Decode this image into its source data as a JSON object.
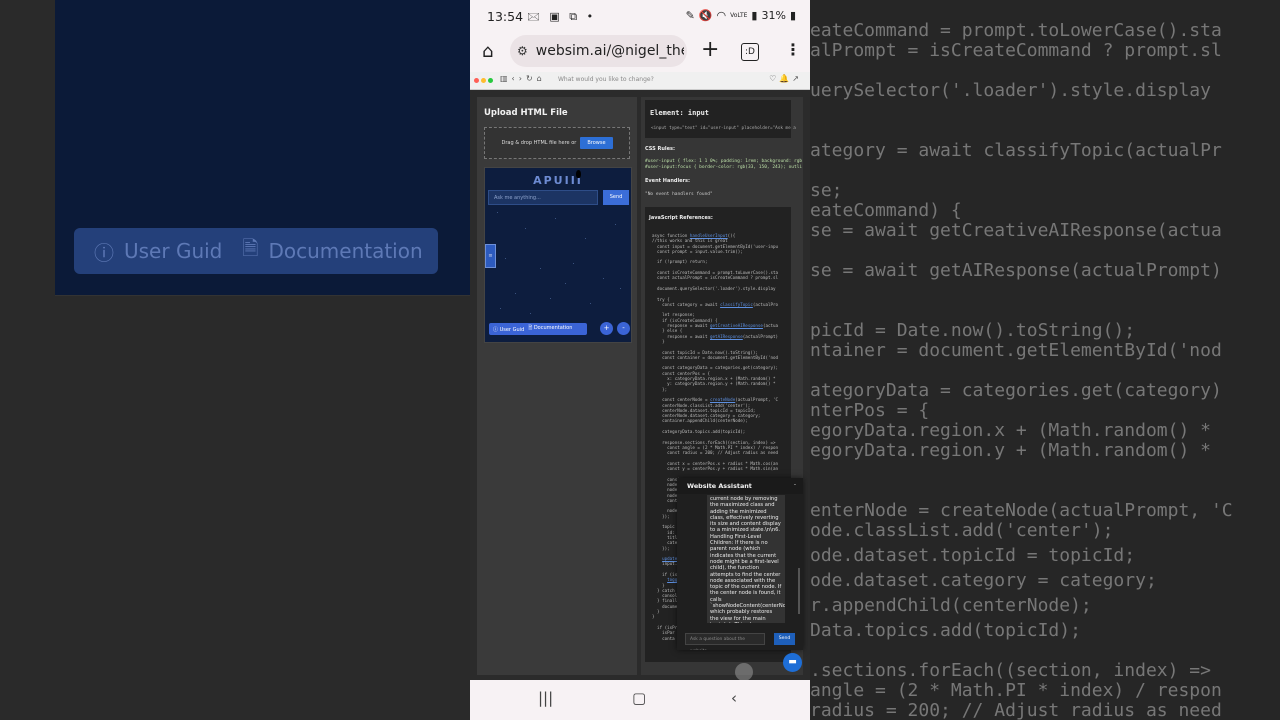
{
  "status_bar": {
    "time": "13:54",
    "notif_icons": "🖂 ▣ ⧉ •",
    "battery": "31%",
    "signal_label": "VoLTE"
  },
  "browser": {
    "url": "websim.ai/@nigel_the_m",
    "tab_count": ":D",
    "inner_prompt": "What would you like to change?"
  },
  "left_panel": {
    "title": "Upload HTML File",
    "drop_text": "Drag & drop HTML file here or",
    "browse_label": "Browse"
  },
  "preview": {
    "app_title": "APUIII",
    "input_placeholder": "Ask me anything...",
    "send_label": "Send",
    "user_guide_label": "User Guid",
    "documentation_label": "Documentation",
    "plus_label": "+",
    "minus_label": "-"
  },
  "inspector": {
    "element_title": "Element: input",
    "element_code": "<input type=\"text\" id=\"user-input\" placeholder=\"Ask me a",
    "css_label": "CSS Rules:",
    "css_line1": "#user-input { flex: 1 1 0%; padding: 1rem; background: rgb",
    "css_line2": "#user-input:focus { border-color: rgb(33, 150, 243); outli",
    "events_label": "Event Handlers:",
    "events_text": "\"No event handlers found\"",
    "js_label": "JavaScript References:",
    "code_lines": [
      "async function handleUserInput(){",
      "//this works and this is great",
      "  const input = document.getElementById('user-inpu",
      "  const prompt = input.value.trim();",
      "",
      "  if (!prompt) return;",
      "",
      "  const isCreateCommand = prompt.toLowerCase().sta",
      "  const actualPrompt = isCreateCommand ? prompt.sl",
      "",
      "  document.querySelector('.loader').style.display",
      "",
      "  try {",
      "    const category = await classifyTopic(actualPro",
      "",
      "    let response;",
      "    if (isCreateCommand) {",
      "      response = await getCreativeAIResponse(actua",
      "    } else {",
      "      response = await getAIResponse(actualPrompt)",
      "    }",
      "",
      "    const topicId = Date.now().toString();",
      "    const container = document.getElementById('nod",
      "",
      "    const categoryData = categories.get(category);",
      "    const centerPos = {",
      "      x: categoryData.region.x + (Math.random() *",
      "      y: categoryData.region.y + (Math.random() *",
      "    };",
      "",
      "    const centerNode = createNode(actualPrompt, 'C",
      "    centerNode.classList.add('center');",
      "    centerNode.dataset.topicId = topicId;",
      "    centerNode.dataset.category = category;",
      "    container.appendChild(centerNode);",
      "",
      "    categoryData.topics.add(topicId);",
      "",
      "    response.sections.forEach((section, index) =>",
      "      const angle = (2 * Math.PI * index) / respon",
      "      const radius = 200; // Adjust radius as need",
      "",
      "      const x = centerPos.x + radius * Math.cos(an",
      "      const y = centerPos.y + radius * Math.sin(an",
      "",
      "      const",
      "      node.",
      "      node.",
      "      node.",
      "      conta",
      "",
      "      nodeP",
      "    });",
      "",
      "    topic",
      "      id: t",
      "      title",
      "      categ",
      "    });",
      "",
      "    updateT",
      "    input.v",
      "",
      "    if (isC",
      "      toggl",
      "    }",
      "  } catch (",
      "    console",
      "  } finally",
      "    documen",
      "  }",
      "}",
      "",
      "  if (isPromi",
      "    isPar",
      "    conta"
    ]
  },
  "assistant": {
    "title": "Website Assistant",
    "close": "-",
    "message": "current node by removing the maximized class and adding the minimized class, effectively reverting its size and content display to a minimized state.\\n\\n6. Handling First-Level Children: If there is no parent node (which indicates that the current node might be a first-level child), the function attempts to find the center node associated with the topic of the current node. If the center node is found, it calls `showNodeContent(centerNode)`, which probably restores the view for the main topic.\\n\\nThis clear structure allows users to navigate back through the hierarchy of nodes in the mind map efficiently. Each step ensures that the UI updates",
    "input_placeholder": "Ask a question about the website...",
    "send_label": "Send"
  },
  "background_right": {
    "lines": [
      "eateCommand = prompt.toLowerCase().sta",
      "alPrompt = isCreateCommand ? prompt.sl",
      "uerySelector('.loader').style.display",
      "ategory = await classifyTopic(actualPr",
      "se;",
      "eateCommand) {",
      "se = await getCreativeAIResponse(actua",
      "se = await getAIResponse(actualPrompt)",
      "picId = Date.now().toString();",
      "ntainer = document.getElementById('nod",
      "ategoryData = categories.get(category)",
      "nterPos = {",
      "egoryData.region.x + (Math.random() *",
      "egoryData.region.y + (Math.random() *",
      "enterNode = createNode(actualPrompt, 'C",
      "ode.classList.add('center');",
      "ode.dataset.topicId = topicId;",
      "ode.dataset.category = category;",
      "r.appendChild(centerNode);",
      "Data.topics.add(topicId);",
      ".sections.forEach((section, index) =>",
      "angle = (2 * Math.PI * index) / respon",
      "radius = 200; // Adjust radius as need"
    ]
  },
  "background_left": {
    "user_guide_label": "User Guid",
    "documentation_label": "Documentation"
  }
}
